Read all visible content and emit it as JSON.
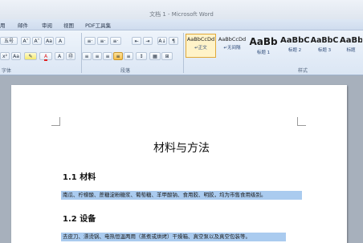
{
  "window": {
    "title": "文档 1 - Microsoft Word"
  },
  "menu": {
    "tabs": [
      "用",
      "邮件",
      "审阅",
      "视图",
      "PDF工具集"
    ]
  },
  "ribbon": {
    "font_size": "五号",
    "row1": [
      "A˄",
      "A˅",
      "Aa",
      "A"
    ],
    "row2": [
      "x²",
      "Aa",
      "A"
    ],
    "para_row1": [
      "≡·",
      "≡·",
      "≡·",
      "⇤",
      "⇥",
      "A↓",
      "¶"
    ],
    "para_row2": [
      "≡",
      "≡",
      "≡",
      "≡",
      "≡",
      "↕",
      "▦",
      "⊞"
    ],
    "groups": {
      "font": "字体",
      "para": "段落",
      "styles": "样式"
    },
    "styles": [
      {
        "sample": "AaBbCcDd",
        "name": "↵正文"
      },
      {
        "sample": "AaBbCcDd",
        "name": "↵无间隔"
      },
      {
        "sample": "AaBb",
        "name": "标题 1"
      },
      {
        "sample": "AaBbC",
        "name": "标题 2"
      },
      {
        "sample": "AaBbC",
        "name": "标题 3"
      },
      {
        "sample": "AaBb",
        "name": "标题"
      }
    ]
  },
  "document": {
    "title": "材料与方法",
    "sections": [
      {
        "heading": "1.1 材料",
        "text": "南瓜、柠檬酸、蔗糖淀粉糖浆、葡萄糖、羊甲酸钠、食用胶、明胶，均为市售食用级别。"
      },
      {
        "heading": "1.2 设备",
        "text": "去皮刀、漂烫锅、电热恒温两用（蒸煮或烘烤）干燥箱、真空泵以及真空包装等。"
      }
    ]
  }
}
